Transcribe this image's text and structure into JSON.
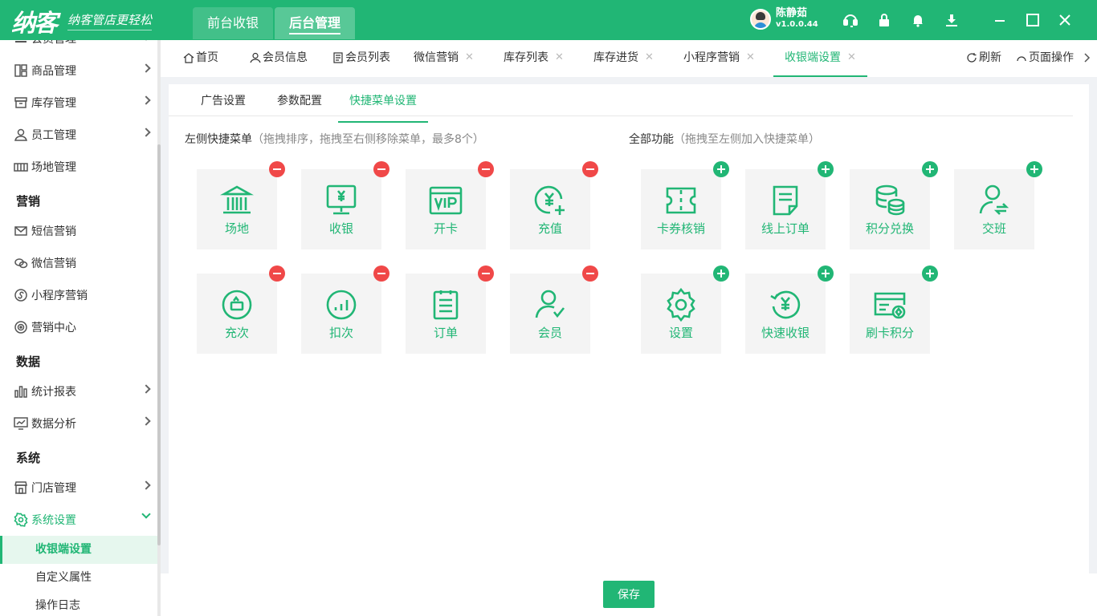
{
  "app": {
    "logo": "纳客",
    "slogan": "纳客管店更轻松"
  },
  "topnav": {
    "front": "前台收银",
    "back": "后台管理"
  },
  "user": {
    "name": "陈静茹",
    "version": "v1.0.0.44"
  },
  "sidebar": {
    "items": [
      {
        "label": "会员管理"
      },
      {
        "label": "商品管理"
      },
      {
        "label": "库存管理"
      },
      {
        "label": "员工管理"
      },
      {
        "label": "场地管理"
      },
      {
        "label": "短信营销"
      },
      {
        "label": "微信营销"
      },
      {
        "label": "小程序营销"
      },
      {
        "label": "营销中心"
      },
      {
        "label": "统计报表"
      },
      {
        "label": "数据分析"
      },
      {
        "label": "门店管理"
      },
      {
        "label": "系统设置"
      }
    ],
    "groups": {
      "marketing": "营销",
      "data": "数据",
      "system": "系统"
    },
    "subitems": [
      {
        "label": "收银端设置"
      },
      {
        "label": "自定义属性"
      },
      {
        "label": "操作日志"
      }
    ]
  },
  "tabs": [
    {
      "label": "首页"
    },
    {
      "label": "会员信息"
    },
    {
      "label": "会员列表"
    },
    {
      "label": "微信营销"
    },
    {
      "label": "库存列表"
    },
    {
      "label": "库存进货"
    },
    {
      "label": "小程序营销"
    },
    {
      "label": "收银端设置"
    }
  ],
  "tab_actions": {
    "refresh": "刷新",
    "page_ops": "页面操作"
  },
  "subtabs": [
    {
      "label": "广告设置"
    },
    {
      "label": "参数配置"
    },
    {
      "label": "快捷菜单设置"
    }
  ],
  "left_section": {
    "title": "左侧快捷菜单",
    "hint": "（拖拽排序，拖拽至右侧移除菜单，最多8个）"
  },
  "right_section": {
    "title": "全部功能",
    "hint": "（拖拽至左侧加入快捷菜单）"
  },
  "left_tiles": [
    {
      "label": "场地",
      "icon": "venue-icon"
    },
    {
      "label": "收银",
      "icon": "cashier-icon"
    },
    {
      "label": "开卡",
      "icon": "vip-card-icon"
    },
    {
      "label": "充值",
      "icon": "recharge-icon"
    },
    {
      "label": "充次",
      "icon": "recharge-times-icon"
    },
    {
      "label": "扣次",
      "icon": "deduct-times-icon"
    },
    {
      "label": "订单",
      "icon": "order-icon"
    },
    {
      "label": "会员",
      "icon": "member-icon"
    }
  ],
  "right_tiles": [
    {
      "label": "卡券核销",
      "icon": "coupon-icon"
    },
    {
      "label": "线上订单",
      "icon": "online-order-icon"
    },
    {
      "label": "积分兑换",
      "icon": "points-exchange-icon"
    },
    {
      "label": "交班",
      "icon": "shift-handover-icon"
    },
    {
      "label": "设置",
      "icon": "settings-icon"
    },
    {
      "label": "快速收银",
      "icon": "quick-cashier-icon"
    },
    {
      "label": "刷卡积分",
      "icon": "card-points-icon"
    }
  ],
  "footer": {
    "save": "保存"
  },
  "colors": {
    "accent": "#21b675",
    "remove": "#f04848"
  }
}
